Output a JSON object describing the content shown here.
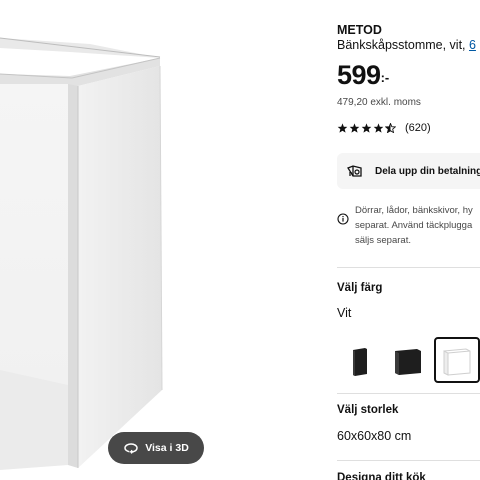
{
  "product": {
    "brand": "METOD",
    "description": "Bänkskåpsstomme, vit, 6",
    "description_main": "Bänkskåpsstomme, vit, ",
    "description_link": "6",
    "price": "599",
    "price_suffix": ":-",
    "price_ex_vat": "479,20 exkl. moms",
    "rating_value": 4.5,
    "review_count": "(620)"
  },
  "payment": {
    "label": "Dela upp din betalning"
  },
  "notice": {
    "lines": [
      "Dörrar, lådor, bänkskivor, hy",
      "separat. Använd täckplugga",
      "säljs separat."
    ]
  },
  "color": {
    "title": "Välj färg",
    "selected": "Vit",
    "swatches": [
      {
        "name": "Svart-small",
        "fill": "#1e1e1e"
      },
      {
        "name": "Svart-large",
        "fill": "#1e1e1e"
      },
      {
        "name": "Vit",
        "fill": "#ffffff"
      }
    ]
  },
  "size": {
    "title": "Välj storlek",
    "selected": "60x60x80 cm"
  },
  "design": {
    "title": "Designa ditt kök"
  },
  "viewer": {
    "view_3d_label": "Visa i 3D"
  },
  "colors": {
    "text": "#111111",
    "muted": "#484848",
    "link": "#0058a3",
    "button_dark": "#484848",
    "card_bg": "#f5f5f5",
    "divider": "#dfdfdf"
  },
  "icons": {
    "view3d": "rotate-3d-icon",
    "payment": "klarna-installments-icon",
    "notice": "info-circle-icon",
    "star": "star-icon"
  }
}
